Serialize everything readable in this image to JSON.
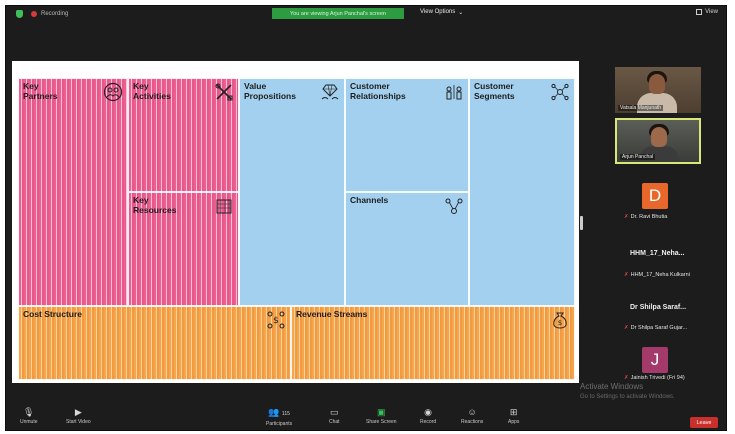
{
  "topbar": {
    "recording_label": "Recording",
    "banner_text": "You are viewing Arjun Panchal's screen",
    "view_options_label": "View Options",
    "view_label": "View"
  },
  "canvas": {
    "key_partners": "Key\nPartners",
    "key_activities": "Key\nActivities",
    "key_resources": "Key\nResources",
    "value_propositions": "Value\nPropositions",
    "customer_relationships": "Customer\nRelationships",
    "channels": "Channels",
    "customer_segments": "Customer\nSegments",
    "cost_structure": "Cost Structure",
    "revenue_streams": "Revenue Streams",
    "colors": {
      "pink": "#ec5f93",
      "blue": "#a3d0ee",
      "orange": "#f5a54c"
    }
  },
  "participants": {
    "p1_name": "Vatsala Manjunath",
    "p2_name": "Arjun Panchal",
    "p3_initial": "D",
    "p3_name": "Dr. Ravi Bhutia",
    "p4_title": "HHM_17_Neha...",
    "p4_name": "HHM_17_Neha Kulkarni",
    "p5_title": "Dr Shilpa Saraf...",
    "p5_name": "Dr Shilpa Saraf Gujar...",
    "p6_initial": "J",
    "p6_name": "Jainish Trivedi (Fri 94)"
  },
  "watermark": {
    "line1": "Activate Windows",
    "line2": "Go to Settings to activate Windows."
  },
  "toolbar": {
    "unmute": "Unmute",
    "start_video": "Start Video",
    "participants_count": "115",
    "participants": "Participants",
    "chat": "Chat",
    "share_screen": "Share Screen",
    "record": "Record",
    "reactions": "Reactions",
    "apps": "Apps",
    "leave": "Leave"
  }
}
